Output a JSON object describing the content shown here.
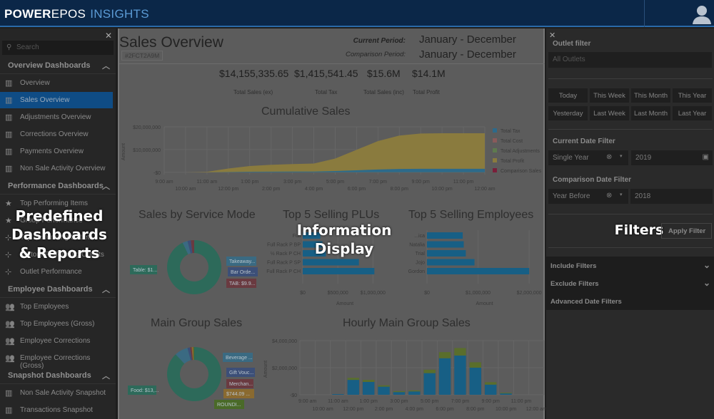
{
  "header": {
    "brand_bold": "POWER",
    "brand_light": "EPOS",
    "product": "INSIGHTS"
  },
  "sidebar": {
    "search_placeholder": "Search",
    "sections": [
      {
        "title": "Overview Dashboards",
        "icon": "bar-chart-icon",
        "items": [
          "Overview",
          "Sales Overview",
          "Adjustments Overview",
          "Corrections Overview",
          "Payments Overview",
          "Non Sale Activity Overview"
        ]
      },
      {
        "title": "Performance Dashboards",
        "icon": "mixed",
        "items": [
          "Top Performing Items",
          "Group Performance",
          "Top Performing Outlets",
          "Bottom Performing Outlets",
          "Outlet Performance"
        ]
      },
      {
        "title": "Employee Dashboards",
        "icon": "users-icon",
        "items": [
          "Top Employees",
          "Top Employees (Gross)",
          "Employee Corrections",
          "Employee Corrections (Gross)"
        ]
      },
      {
        "title": "Snapshot Dashboards",
        "icon": "bar-chart-icon",
        "items": [
          "Non Sale Activity Snapshot",
          "Transactions Snapshot"
        ]
      }
    ],
    "active_item": "Sales Overview"
  },
  "overlay_labels": {
    "left": "Predefined Dashboards & Reports",
    "center": "Information Display",
    "right": "Filters"
  },
  "main": {
    "title": "Sales Overview",
    "code": "#2FCT2A9M",
    "current_period_label": "Current Period:",
    "current_period": "January - December",
    "comparison_period_label": "Comparison Period:",
    "comparison_period": "January - December",
    "kpis": [
      {
        "value": "$14,155,335.65",
        "label": "Total Sales (ex)"
      },
      {
        "value": "$1,415,541.45",
        "label": "Total Tax"
      },
      {
        "value": "$15.6M",
        "label": "Total Sales (inc)"
      },
      {
        "value": "$14.1M",
        "label": "Total Profit"
      }
    ],
    "service_mode": {
      "title": "Sales by Service Mode",
      "labels": [
        "Table: $1...",
        "Takeaway...",
        "Bar Orde...",
        "TAB: $9.9..."
      ]
    },
    "main_group": {
      "title": "Main Group Sales",
      "labels": [
        "Food: $13,...",
        "Beverage ...",
        "Gift Vouc...",
        "Merchan...",
        "$744.09 ...",
        "ROUNDI..."
      ]
    }
  },
  "chart_data": [
    {
      "type": "area",
      "title": "Cumulative Sales",
      "ylabel": "Amount",
      "ylim": [
        -1000000,
        20000000
      ],
      "yticks": [
        "-$0",
        "$10,000,000",
        "$20,000,000"
      ],
      "x": [
        "9:00 am",
        "10:00 am",
        "11:00 am",
        "12:00 pm",
        "1:00 pm",
        "2:00 pm",
        "3:00 pm",
        "4:00 pm",
        "5:00 pm",
        "6:00 pm",
        "7:00 pm",
        "8:00 pm",
        "9:00 pm",
        "10:00 pm",
        "11:00 pm",
        "12:00 am"
      ],
      "series": [
        {
          "name": "Total Tax",
          "color": "#2d6a8a",
          "values": [
            0,
            0,
            20000,
            150000,
            250000,
            300000,
            330000,
            350000,
            550000,
            900000,
            1250000,
            1470000,
            1550000,
            1560000,
            1560000,
            1560000
          ]
        },
        {
          "name": "Total Cost",
          "color": "#8a5a5a",
          "values": [
            0,
            0,
            0,
            0,
            0,
            0,
            0,
            0,
            0,
            0,
            0,
            0,
            0,
            0,
            0,
            0
          ]
        },
        {
          "name": "Total Adjustments",
          "color": "#5e7a4e",
          "values": [
            0,
            0,
            0,
            0,
            0,
            0,
            0,
            0,
            0,
            0,
            0,
            0,
            0,
            0,
            0,
            0
          ]
        },
        {
          "name": "Total Profit",
          "color": "#8a7b3e",
          "values": [
            0,
            0,
            200000,
            1500000,
            2500000,
            3000000,
            3300000,
            3500000,
            5500000,
            9000000,
            12500000,
            14700000,
            15500000,
            15600000,
            15600000,
            15600000
          ]
        },
        {
          "name": "Comparison Sales",
          "color": "#7a1f3a",
          "values": []
        }
      ],
      "legend": "right"
    },
    {
      "type": "bar",
      "orientation": "horizontal",
      "title": "Top 5 Selling PLUs",
      "xlabel": "Amount",
      "legend_entry": "Total Amount",
      "categories": [
        "Full",
        "Full Rack P BP",
        "½ Rack P CH",
        "Full Rack P SP",
        "Full Rack P CH"
      ],
      "values": [
        250000,
        280000,
        330000,
        800000,
        1020000
      ],
      "xlim": [
        0,
        1200000
      ],
      "xticks": [
        "$0",
        "$500,000",
        "$1,000,000"
      ],
      "color": "#175f85"
    },
    {
      "type": "bar",
      "orientation": "horizontal",
      "title": "Top 5 Selling Employees",
      "xlabel": "Amount",
      "legend_entry": "Total Amount",
      "categories": [
        "...ica",
        "Natalia",
        "Trial",
        "Jojo",
        "Gordon"
      ],
      "values": [
        700000,
        720000,
        760000,
        930000,
        2000000
      ],
      "xlim": [
        0,
        2250000
      ],
      "xticks": [
        "$0",
        "$1,000,000",
        "$2,000,000"
      ],
      "color": "#175f85"
    },
    {
      "type": "bar",
      "stacked": true,
      "title": "Hourly Main Group Sales",
      "ylabel": "Amount",
      "ylim": [
        0,
        4000000
      ],
      "yticks": [
        "-$0",
        "$2,000,000",
        "$4,000,000"
      ],
      "x": [
        "9:00 am",
        "10:00 am",
        "11:00 am",
        "12:00 pm",
        "1:00 pm",
        "2:00 pm",
        "3:00 pm",
        "4:00 pm",
        "5:00 pm",
        "6:00 pm",
        "7:00 pm",
        "8:00 pm",
        "9:00 pm",
        "10:00 pm",
        "11:00 pm",
        "12:00 am"
      ],
      "series": [
        {
          "color": "#175f85",
          "values": [
            0,
            0,
            50000,
            1100000,
            950000,
            600000,
            200000,
            250000,
            1600000,
            2700000,
            2900000,
            2000000,
            750000,
            100000,
            0,
            0
          ]
        },
        {
          "color": "#5a6e2c",
          "values": [
            0,
            0,
            0,
            150000,
            150000,
            100000,
            70000,
            70000,
            250000,
            450000,
            550000,
            400000,
            180000,
            50000,
            0,
            0
          ]
        }
      ]
    }
  ],
  "filters": {
    "outlet_label": "Outlet filter",
    "outlet_placeholder": "All Outlets",
    "quick": [
      "Today",
      "This Week",
      "This Month",
      "This Year",
      "Yesterday",
      "Last Week",
      "Last Month",
      "Last Year"
    ],
    "current_label": "Current Date Filter",
    "current_type": "Single Year",
    "current_value": "2019",
    "comparison_label": "Comparison Date Filter",
    "comparison_type": "Year Before",
    "comparison_value": "2018",
    "apply": "Apply Filter",
    "accordions": [
      "Include Filters",
      "Exclude Filters",
      "Advanced Date Filters"
    ]
  }
}
